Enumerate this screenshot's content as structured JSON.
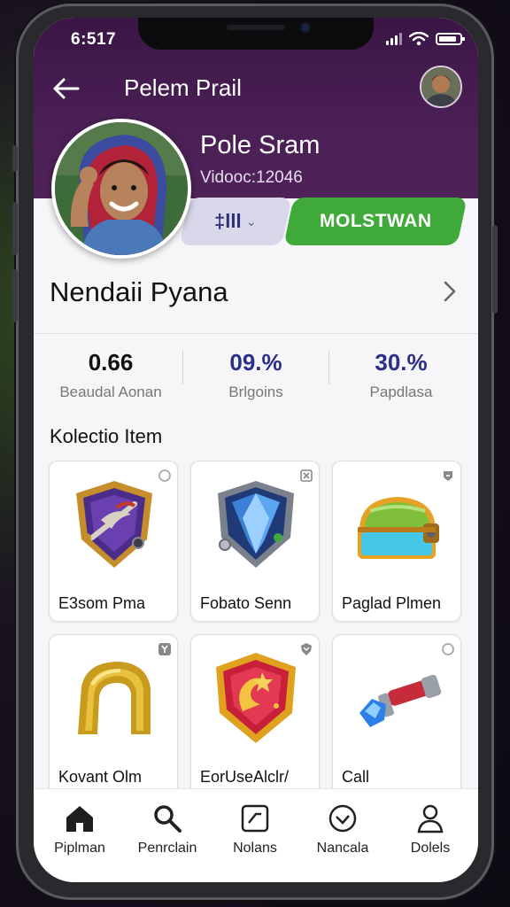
{
  "status_bar": {
    "time": "6:517"
  },
  "header": {
    "title": "Pelem Prail"
  },
  "profile": {
    "name": "Pole Sram",
    "id_text": "Vidooc:12046",
    "secondary_pill_label": "‡lll",
    "primary_button_label": "MOLSTWAN"
  },
  "section": {
    "name": "Nendaii Pyana"
  },
  "stats": [
    {
      "value": "0.66",
      "label": "Beaudal Aonan",
      "color": "#111111"
    },
    {
      "value": "09.%",
      "label": "Brlgoins",
      "color": "#2b2f8a"
    },
    {
      "value": "30.%",
      "label": "Papdlasa",
      "color": "#2b2f8a"
    }
  ],
  "collection": {
    "title": "Kolectio Item",
    "items": [
      {
        "name": "E3som Pma",
        "icon": "shield-bird-icon",
        "corner_icon": "circle-icon"
      },
      {
        "name": "Fobato Senn",
        "icon": "blue-shield-icon",
        "corner_icon": "close-square-icon"
      },
      {
        "name": "Paglad Plmen",
        "icon": "treasure-chest-icon",
        "corner_icon": "lock-badge-icon"
      },
      {
        "name": "Kovant Olm",
        "icon": "gold-arch-icon",
        "corner_icon": "badge-y-icon"
      },
      {
        "name": "EorUseAlclr/",
        "icon": "red-emblem-icon",
        "corner_icon": "shield-badge-icon"
      },
      {
        "name": "Call",
        "icon": "gem-scepter-icon",
        "corner_icon": "circle-icon"
      }
    ]
  },
  "nav": [
    {
      "label": "Piplman",
      "icon": "home-icon"
    },
    {
      "label": "Penrclain",
      "icon": "search-icon"
    },
    {
      "label": "Nolans",
      "icon": "chart-icon"
    },
    {
      "label": "Nancala",
      "icon": "check-circle-icon"
    },
    {
      "label": "Dolels",
      "icon": "profile-icon"
    }
  ],
  "colors": {
    "header_purple": "#4a1f55",
    "primary_green": "#3fa93a",
    "stat_blue": "#2b2f8a"
  }
}
